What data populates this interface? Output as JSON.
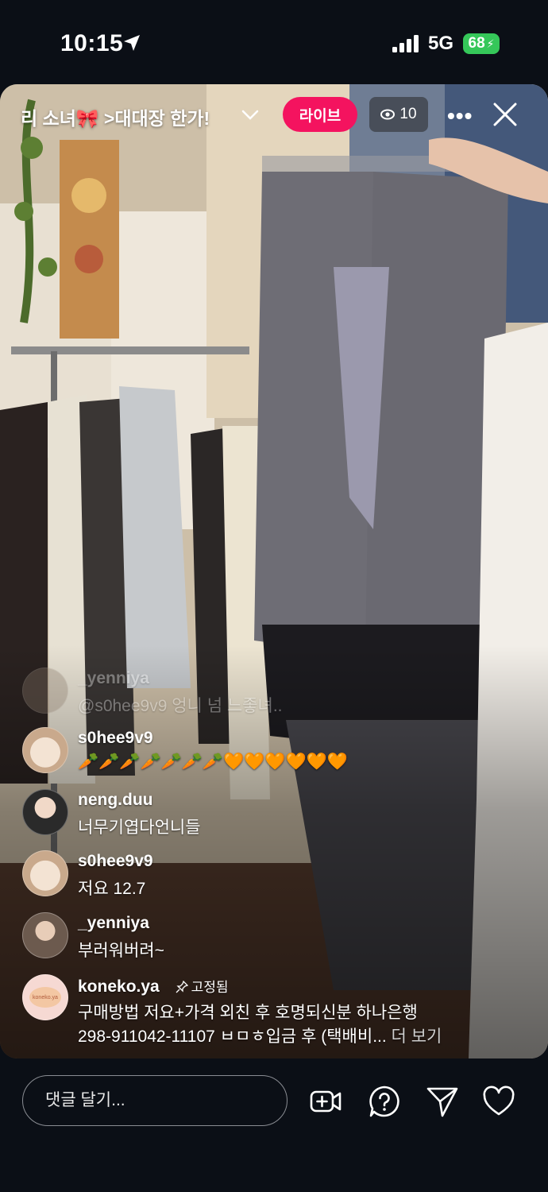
{
  "status_bar": {
    "time": "10:15",
    "network": "5G",
    "battery": "68"
  },
  "live": {
    "title": "리 소녀🎀 >대대장 한가!",
    "badge": "라이브",
    "viewer_count": "10",
    "live_color": "#f4135f"
  },
  "comments": [
    {
      "user": "_yenniya",
      "text": "@s0hee9v9 엉니 넘 느좋녀..",
      "faded": true
    },
    {
      "user": "s0hee9v9",
      "text": "🥕🥕🥕🥕🥕🥕🥕🧡🧡🧡🧡🧡🧡"
    },
    {
      "user": "neng.duu",
      "text": "너무기엽다언니들"
    },
    {
      "user": "s0hee9v9",
      "text": "저요 12.7"
    },
    {
      "user": "_yenniya",
      "text": "부러워버려~"
    }
  ],
  "pinned": {
    "user": "koneko.ya",
    "pin_label": "고정됨",
    "line1": "구매방법 저요+가격 외친 후 호명되신분 하나은행",
    "line2": "298-911042-11107 ㅂㅁㅎ입금 후 (택배비...",
    "more": "더 보기",
    "avatar_text": "koneko.ya"
  },
  "bottom_bar": {
    "input_placeholder": "댓글 달기...",
    "icons": [
      "add-video-icon",
      "question-icon",
      "send-icon",
      "heart-icon"
    ]
  }
}
